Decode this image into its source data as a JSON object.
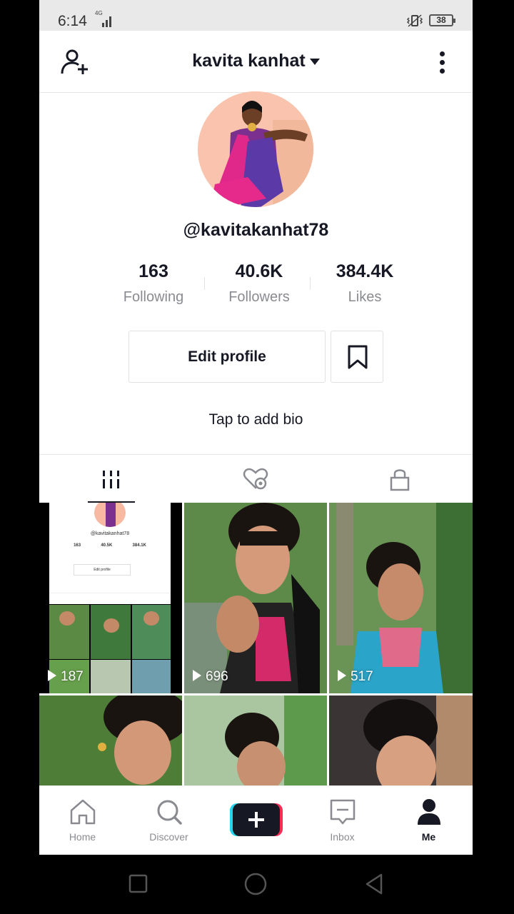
{
  "status_bar": {
    "time": "6:14",
    "network": "4G",
    "battery": "38"
  },
  "header": {
    "title": "kavita kanhat"
  },
  "profile": {
    "handle": "@kavitakanhat78",
    "stats": [
      {
        "value": "163",
        "label": "Following"
      },
      {
        "value": "40.6K",
        "label": "Followers"
      },
      {
        "value": "384.4K",
        "label": "Likes"
      }
    ],
    "edit_label": "Edit profile",
    "bio_prompt": "Tap to add bio"
  },
  "tabs": [
    "videos-grid-icon",
    "liked-icon",
    "lock-icon"
  ],
  "videos": [
    {
      "plays": "187"
    },
    {
      "plays": "696"
    },
    {
      "plays": "517"
    },
    {
      "plays": ""
    },
    {
      "plays": ""
    },
    {
      "plays": ""
    }
  ],
  "thumb_mini": {
    "handle": "@kavitakanhat78",
    "stats": [
      "163",
      "40.5K",
      "384.1K"
    ],
    "edit": "Edit profile"
  },
  "nav": [
    {
      "label": "Home",
      "icon": "home-icon"
    },
    {
      "label": "Discover",
      "icon": "search-icon"
    },
    {
      "label": "",
      "icon": "create-plus-icon"
    },
    {
      "label": "Inbox",
      "icon": "inbox-icon"
    },
    {
      "label": "Me",
      "icon": "profile-icon"
    }
  ],
  "colors": {
    "plus_left": "#20d5ec",
    "plus_right": "#fe2c55",
    "text": "#161823",
    "muted": "#8a8b91"
  }
}
